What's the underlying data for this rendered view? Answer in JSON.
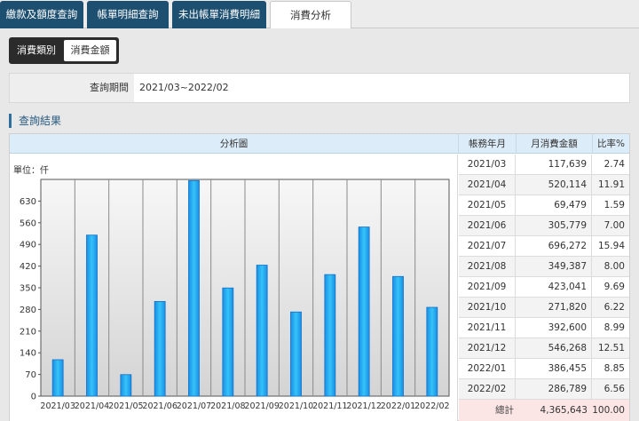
{
  "tabs": [
    {
      "label": "繳款及額度查詢"
    },
    {
      "label": "帳單明細查詢"
    },
    {
      "label": "未出帳單消費明細"
    },
    {
      "label": "消費分析"
    }
  ],
  "subtabs": [
    {
      "label": "消費類別"
    },
    {
      "label": "消費金額"
    }
  ],
  "period": {
    "label": "查詢期間",
    "value": "2021/03~2022/02"
  },
  "result": {
    "title": "查詢結果",
    "headers": {
      "chart": "分析圖",
      "month": "帳務年月",
      "amount": "月消費金額",
      "ratio": "比率%"
    },
    "unit": "單位：仟",
    "rows": [
      {
        "month": "2021/03",
        "amount": "117,639",
        "ratio": "2.74"
      },
      {
        "month": "2021/04",
        "amount": "520,114",
        "ratio": "11.91"
      },
      {
        "month": "2021/05",
        "amount": "69,479",
        "ratio": "1.59"
      },
      {
        "month": "2021/06",
        "amount": "305,779",
        "ratio": "7.00"
      },
      {
        "month": "2021/07",
        "amount": "696,272",
        "ratio": "15.94"
      },
      {
        "month": "2021/08",
        "amount": "349,387",
        "ratio": "8.00"
      },
      {
        "month": "2021/09",
        "amount": "423,041",
        "ratio": "9.69"
      },
      {
        "month": "2021/10",
        "amount": "271,820",
        "ratio": "6.22"
      },
      {
        "month": "2021/11",
        "amount": "392,600",
        "ratio": "8.99"
      },
      {
        "month": "2021/12",
        "amount": "546,268",
        "ratio": "12.51"
      },
      {
        "month": "2022/01",
        "amount": "386,455",
        "ratio": "8.85"
      },
      {
        "month": "2022/02",
        "amount": "286,789",
        "ratio": "6.56"
      }
    ],
    "total": {
      "label": "總計",
      "amount": "4,365,643",
      "ratio": "100.00"
    }
  },
  "colors": {
    "tab_bg": "#1c4f70",
    "bar_top": "#35c3f7",
    "bar_bottom": "#1a8ee8",
    "total_bg": "#fbe5e5"
  },
  "chart_data": {
    "type": "bar",
    "categories": [
      "2021/03",
      "2021/04",
      "2021/05",
      "2021/06",
      "2021/07",
      "2021/08",
      "2021/09",
      "2021/10",
      "2021/11",
      "2021/12",
      "2022/01",
      "2022/02"
    ],
    "values": [
      117.639,
      520.114,
      69.479,
      305.779,
      696.272,
      349.387,
      423.041,
      271.82,
      392.6,
      546.268,
      386.455,
      286.789
    ],
    "yticks": [
      0,
      70,
      140,
      210,
      280,
      350,
      420,
      490,
      560,
      630
    ],
    "ylim": [
      0,
      700
    ],
    "grid": "vertical",
    "title": "",
    "xlabel": "",
    "ylabel": ""
  }
}
